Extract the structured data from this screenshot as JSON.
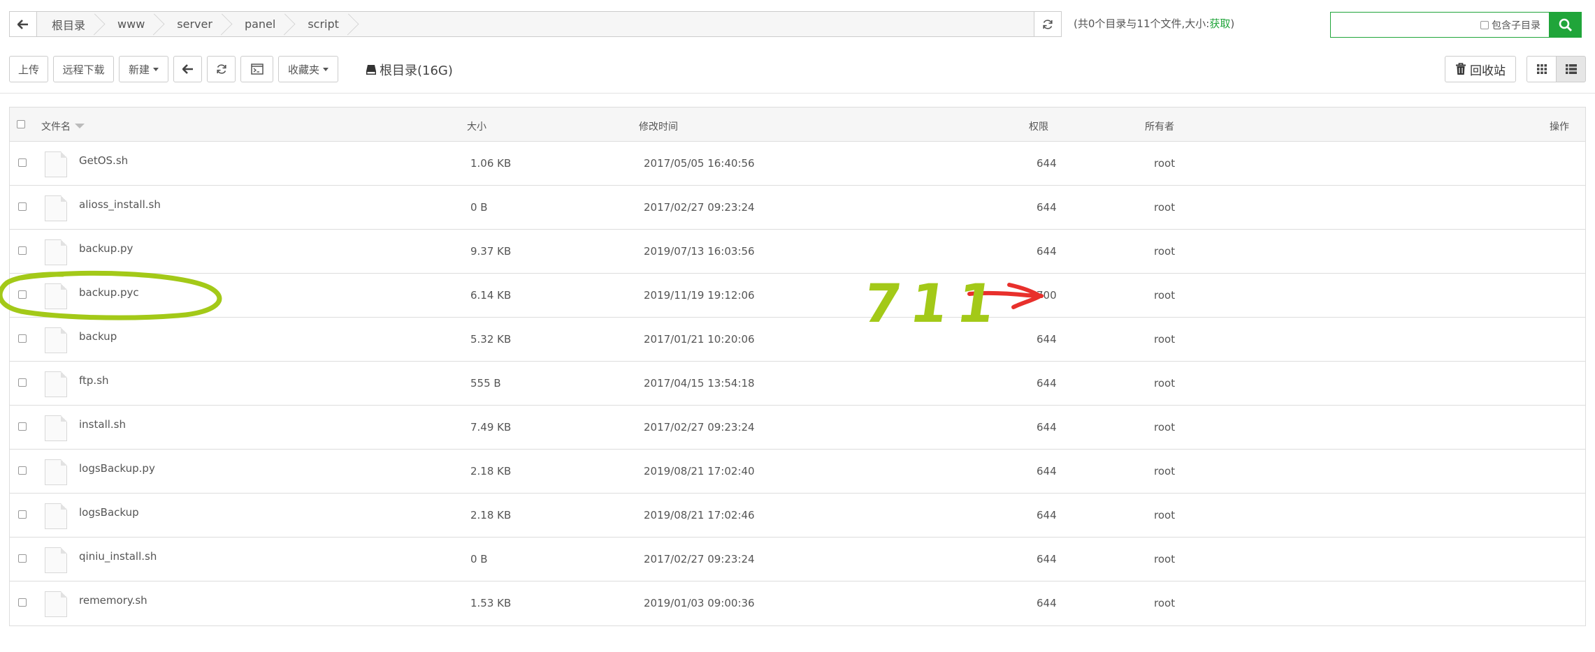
{
  "pathbar": {
    "crumbs": [
      "根目录",
      "www",
      "server",
      "panel",
      "script"
    ],
    "summary_text": "(共0个目录与11个文件,大小:",
    "summary_link": "获取",
    "summary_close": ")"
  },
  "search": {
    "placeholder": "",
    "include_subdirs_label": "包含子目录"
  },
  "toolbar": {
    "upload": "上传",
    "remote_download": "远程下载",
    "new": "新建",
    "favorites": "收藏夹",
    "disk_label": "根目录(16G)",
    "recycle": "回收站"
  },
  "table": {
    "columns": {
      "name": "文件名",
      "size": "大小",
      "mtime": "修改时间",
      "perm": "权限",
      "owner": "所有者",
      "actions": "操作"
    },
    "rows": [
      {
        "name": "GetOS.sh",
        "size": "1.06 KB",
        "mtime": "2017/05/05 16:40:56",
        "perm": "644",
        "owner": "root"
      },
      {
        "name": "alioss_install.sh",
        "size": "0 B",
        "mtime": "2017/02/27 09:23:24",
        "perm": "644",
        "owner": "root"
      },
      {
        "name": "backup.py",
        "size": "9.37 KB",
        "mtime": "2019/07/13 16:03:56",
        "perm": "644",
        "owner": "root"
      },
      {
        "name": "backup.pyc",
        "size": "6.14 KB",
        "mtime": "2019/11/19 19:12:06",
        "perm": "700",
        "owner": "root"
      },
      {
        "name": "backup",
        "size": "5.32 KB",
        "mtime": "2017/01/21 10:20:06",
        "perm": "644",
        "owner": "root"
      },
      {
        "name": "ftp.sh",
        "size": "555 B",
        "mtime": "2017/04/15 13:54:18",
        "perm": "644",
        "owner": "root"
      },
      {
        "name": "install.sh",
        "size": "7.49 KB",
        "mtime": "2017/02/27 09:23:24",
        "perm": "644",
        "owner": "root"
      },
      {
        "name": "logsBackup.py",
        "size": "2.18 KB",
        "mtime": "2019/08/21 17:02:40",
        "perm": "644",
        "owner": "root"
      },
      {
        "name": "logsBackup",
        "size": "2.18 KB",
        "mtime": "2019/08/21 17:02:46",
        "perm": "644",
        "owner": "root"
      },
      {
        "name": "qiniu_install.sh",
        "size": "0 B",
        "mtime": "2017/02/27 09:23:24",
        "perm": "644",
        "owner": "root"
      },
      {
        "name": "rememory.sh",
        "size": "1.53 KB",
        "mtime": "2019/01/03 09:00:36",
        "perm": "644",
        "owner": "root"
      }
    ]
  },
  "annotations": {
    "handwritten_text": "711",
    "circle_color": "#a3c918",
    "arrow_color": "#e8302c"
  },
  "colors": {
    "accent": "#20a53a",
    "border": "#cccccc",
    "header_bg": "#f6f6f6"
  },
  "icons": {
    "back": "arrow-left-icon",
    "refresh": "refresh-icon",
    "search": "search-icon",
    "terminal": "terminal-icon",
    "disk": "hard-drive-icon",
    "trash": "trash-icon",
    "grid": "grid-view-icon",
    "list": "list-view-icon",
    "file": "file-icon"
  }
}
